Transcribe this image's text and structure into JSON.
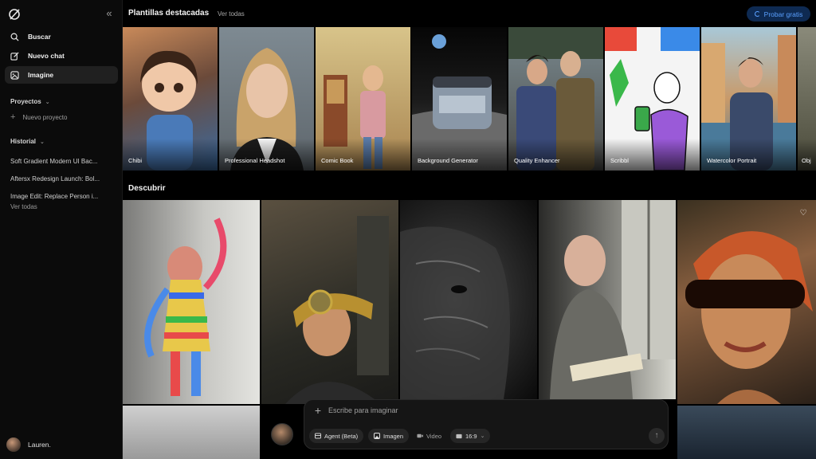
{
  "sidebar": {
    "nav": [
      {
        "label": "Buscar",
        "icon": "search-icon"
      },
      {
        "label": "Nuevo chat",
        "icon": "edit-icon"
      },
      {
        "label": "Imagine",
        "icon": "image-icon"
      }
    ],
    "projects_label": "Proyectos",
    "new_project_label": "Nuevo proyecto",
    "history_label": "Historial",
    "history": [
      "Soft Gradient Modern UI Bac...",
      "Aftersx Redesign Launch: Bol...",
      "Image Edit: Replace Person i..."
    ],
    "see_all_label": "Ver todas",
    "user_name": "Lauren."
  },
  "header": {
    "title": "Plantillas destacadas",
    "see_all_label": "Ver todas",
    "try_free_label": "Probar gratis"
  },
  "templates": [
    {
      "label": "Chibi"
    },
    {
      "label": "Professional Headshot"
    },
    {
      "label": "Comic Book"
    },
    {
      "label": "Background Generator"
    },
    {
      "label": "Quality Enhancer"
    },
    {
      "label": "Scribbl"
    },
    {
      "label": "Watercolor Portrait"
    },
    {
      "label": "Obj"
    }
  ],
  "discover": {
    "title": "Descubrir"
  },
  "composer": {
    "placeholder": "Escribe para imaginar",
    "chips": [
      {
        "label": "Agent (Beta)",
        "icon": "agent-icon"
      },
      {
        "label": "Imagen",
        "icon": "image-icon"
      },
      {
        "label": "Video",
        "icon": "video-icon"
      },
      {
        "label": "16:9",
        "icon": "aspect-icon"
      }
    ]
  },
  "colors": {
    "accent": "#5aa0ff",
    "accent_bg": "#0e2a52",
    "sidebar_bg": "#0b0b0b",
    "active_bg": "#202020"
  }
}
